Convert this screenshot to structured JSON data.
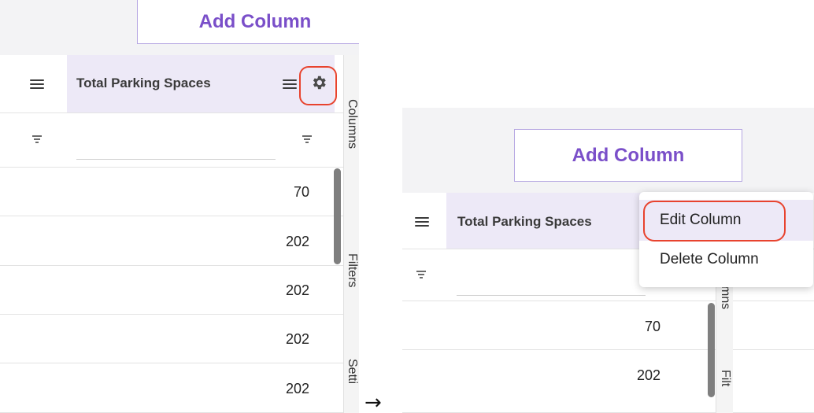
{
  "left": {
    "add_column_label": "Add Column",
    "header_label": "Total Parking Spaces",
    "values": [
      "70",
      "202",
      "202",
      "202",
      "202"
    ],
    "side_tabs": {
      "columns": "Columns",
      "filters": "Filters",
      "settings": "Setti"
    }
  },
  "right": {
    "add_column_label": "Add Column",
    "header_label": "Total Parking Spaces",
    "values": [
      "70",
      "202"
    ],
    "side_tabs": {
      "columns": "mns",
      "filters": "Filt"
    },
    "menu": {
      "edit": "Edit Column",
      "delete": "Delete Column"
    }
  },
  "arrow": "→",
  "colors": {
    "accent": "#7a4fc9",
    "highlight": "#e8432e",
    "header_shade": "#ede9f7"
  },
  "icons": {
    "settings": "gear-icon",
    "column_menu": "hamburger-icon",
    "filter": "filter-icon"
  }
}
